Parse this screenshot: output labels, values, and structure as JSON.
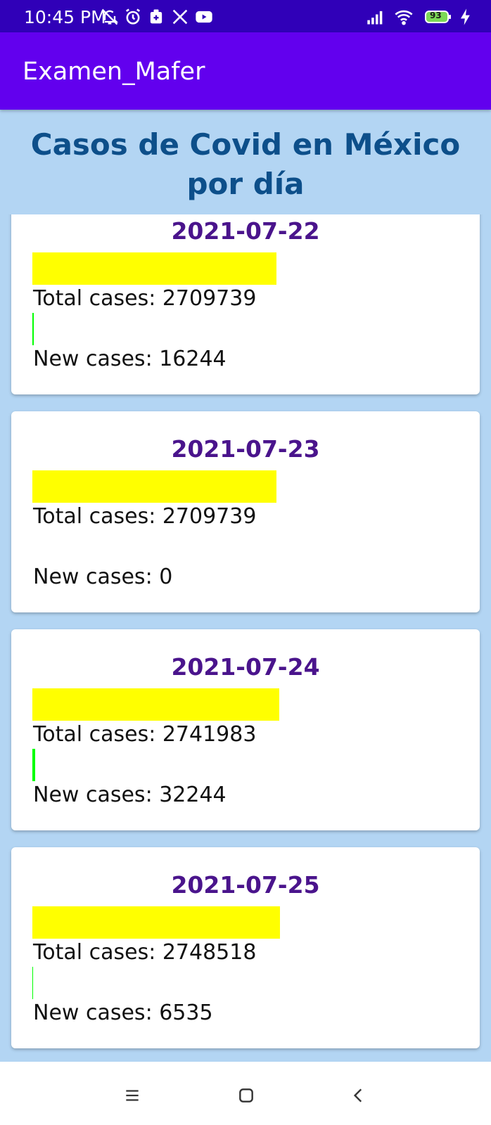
{
  "status_bar": {
    "time": "10:45 PM",
    "battery": "93",
    "icons": [
      "notifications-off-icon",
      "alarm-icon",
      "app-notification-icon",
      "x-icon",
      "youtube-icon",
      "signal-icon",
      "wifi-icon",
      "battery-icon",
      "charging-icon"
    ]
  },
  "app_bar": {
    "title": "Examen_Mafer"
  },
  "heading": "Casos de Covid en México por día",
  "colors": {
    "status_bar": "#3000b8",
    "app_bar": "#6200ee",
    "background": "#b3d5f3",
    "heading": "#0d4f8a",
    "date": "#4a148c",
    "total_bar": "#ffff00",
    "new_bar": "#00ff00"
  },
  "items": [
    {
      "date": "2021-07-22",
      "total_label": "Total cases: 2709739",
      "new_label": "New cases: 16244",
      "total_cases": 2709739,
      "new_cases": 16244
    },
    {
      "date": "2021-07-23",
      "total_label": "Total cases: 2709739",
      "new_label": "New cases: 0",
      "total_cases": 2709739,
      "new_cases": 0
    },
    {
      "date": "2021-07-24",
      "total_label": "Total cases: 2741983",
      "new_label": "New cases: 32244",
      "total_cases": 2741983,
      "new_cases": 32244
    },
    {
      "date": "2021-07-25",
      "total_label": "Total cases: 2748518",
      "new_label": "New cases: 6535",
      "total_cases": 2748518,
      "new_cases": 6535
    }
  ],
  "nav_bar": {
    "buttons": [
      "menu-icon",
      "home-icon",
      "back-icon"
    ]
  }
}
